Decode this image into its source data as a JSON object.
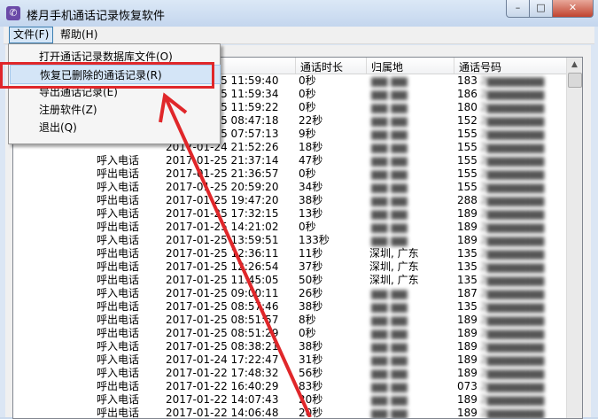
{
  "window": {
    "title": "楼月手机通话记录恢复软件",
    "icon": "phone-icon",
    "controls": {
      "minimize": "–",
      "maximize": "□",
      "close": "✕"
    }
  },
  "menubar": {
    "file": "文件(F)",
    "help": "帮助(H)"
  },
  "file_menu": {
    "items": [
      {
        "label": "打开通话记录数据库文件(O)"
      },
      {
        "label": "恢复已删除的通话记录(R)",
        "highlighted": true
      },
      {
        "label": "导出通话记录(E)"
      },
      {
        "label": "注册软件(Z)"
      },
      {
        "label": "退出(Q)"
      }
    ]
  },
  "table": {
    "headers": {
      "duration": "通话时长",
      "location": "归属地",
      "number": "通话号码"
    },
    "rows": [
      {
        "type": "",
        "time": "2017-01-25 11:59:40",
        "duration": "0秒",
        "location": "",
        "number": "183"
      },
      {
        "type": "",
        "time": "2017-01-25 11:59:34",
        "duration": "0秒",
        "location": "",
        "number": "186"
      },
      {
        "type": "",
        "time": "2017-01-25 11:59:22",
        "duration": "0秒",
        "location": "",
        "number": "180"
      },
      {
        "type": "",
        "time": "2017-01-25 08:47:18",
        "duration": "22秒",
        "location": "",
        "number": "152"
      },
      {
        "type": "",
        "time": "2017-01-25 07:57:13",
        "duration": "9秒",
        "location": "",
        "number": "155"
      },
      {
        "type": "",
        "time": "2017-01-24 21:52:26",
        "duration": "18秒",
        "location": "",
        "number": "155"
      },
      {
        "type": "呼入电话",
        "time": "2017-01-25 21:37:14",
        "duration": "47秒",
        "location": "",
        "number": "155"
      },
      {
        "type": "呼出电话",
        "time": "2017-01-25 21:36:57",
        "duration": "0秒",
        "location": "",
        "number": "155"
      },
      {
        "type": "呼入电话",
        "time": "2017-01-25 20:59:20",
        "duration": "34秒",
        "location": "",
        "number": "155"
      },
      {
        "type": "呼出电话",
        "time": "2017-01-25 19:47:20",
        "duration": "38秒",
        "location": "",
        "number": "288"
      },
      {
        "type": "呼入电话",
        "time": "2017-01-25 17:32:15",
        "duration": "13秒",
        "location": "",
        "number": "189"
      },
      {
        "type": "呼出电话",
        "time": "2017-01-25 14:21:02",
        "duration": "0秒",
        "location": "",
        "number": "189"
      },
      {
        "type": "呼入电话",
        "time": "2017-01-25 13:59:51",
        "duration": "133秒",
        "location": "",
        "number": "189"
      },
      {
        "type": "呼出电话",
        "time": "2017-01-25 12:36:11",
        "duration": "11秒",
        "location": "深圳, 广东",
        "number": "135"
      },
      {
        "type": "呼出电话",
        "time": "2017-01-25 12:26:54",
        "duration": "37秒",
        "location": "深圳, 广东",
        "number": "135"
      },
      {
        "type": "呼出电话",
        "time": "2017-01-25 11:45:05",
        "duration": "50秒",
        "location": "深圳, 广东",
        "number": "135"
      },
      {
        "type": "呼入电话",
        "time": "2017-01-25 09:00:11",
        "duration": "26秒",
        "location": "",
        "number": "187"
      },
      {
        "type": "呼出电话",
        "time": "2017-01-25 08:57:46",
        "duration": "38秒",
        "location": "",
        "number": "135"
      },
      {
        "type": "呼出电话",
        "time": "2017-01-25 08:51:57",
        "duration": "8秒",
        "location": "",
        "number": "189"
      },
      {
        "type": "呼出电话",
        "time": "2017-01-25 08:51:29",
        "duration": "0秒",
        "location": "",
        "number": "189"
      },
      {
        "type": "呼入电话",
        "time": "2017-01-25 08:38:21",
        "duration": "38秒",
        "location": "",
        "number": "189"
      },
      {
        "type": "呼入电话",
        "time": "2017-01-24 17:22:47",
        "duration": "31秒",
        "location": "",
        "number": "189"
      },
      {
        "type": "呼入电话",
        "time": "2017-01-22 17:48:32",
        "duration": "56秒",
        "location": "",
        "number": "189"
      },
      {
        "type": "呼出电话",
        "time": "2017-01-22 16:40:29",
        "duration": "83秒",
        "location": "",
        "number": "073"
      },
      {
        "type": "呼入电话",
        "time": "2017-01-22 14:07:43",
        "duration": "20秒",
        "location": "",
        "number": "189"
      },
      {
        "type": "呼出电话",
        "time": "2017-01-22 14:06:48",
        "duration": "20秒",
        "location": "",
        "number": "189"
      }
    ]
  },
  "annotation": {
    "color": "#e0272a"
  }
}
